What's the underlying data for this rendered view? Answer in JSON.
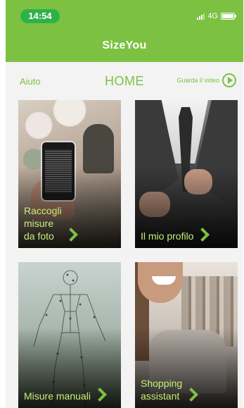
{
  "status_bar": {
    "time": "14:54",
    "network": "4G"
  },
  "app": {
    "title": "SizeYou"
  },
  "nav": {
    "help": "Aiuto",
    "home": "HOME",
    "video": "Guarda il video"
  },
  "tiles": [
    {
      "label": "Raccogli\nmisure\nda foto"
    },
    {
      "label": "Il mio profilo"
    },
    {
      "label": "Misure manuali"
    },
    {
      "label": "Shopping\nassistant"
    }
  ],
  "colors": {
    "brand_green": "#7dc142",
    "time_pill": "#2fb14a",
    "label_text": "#c8ef7a"
  }
}
